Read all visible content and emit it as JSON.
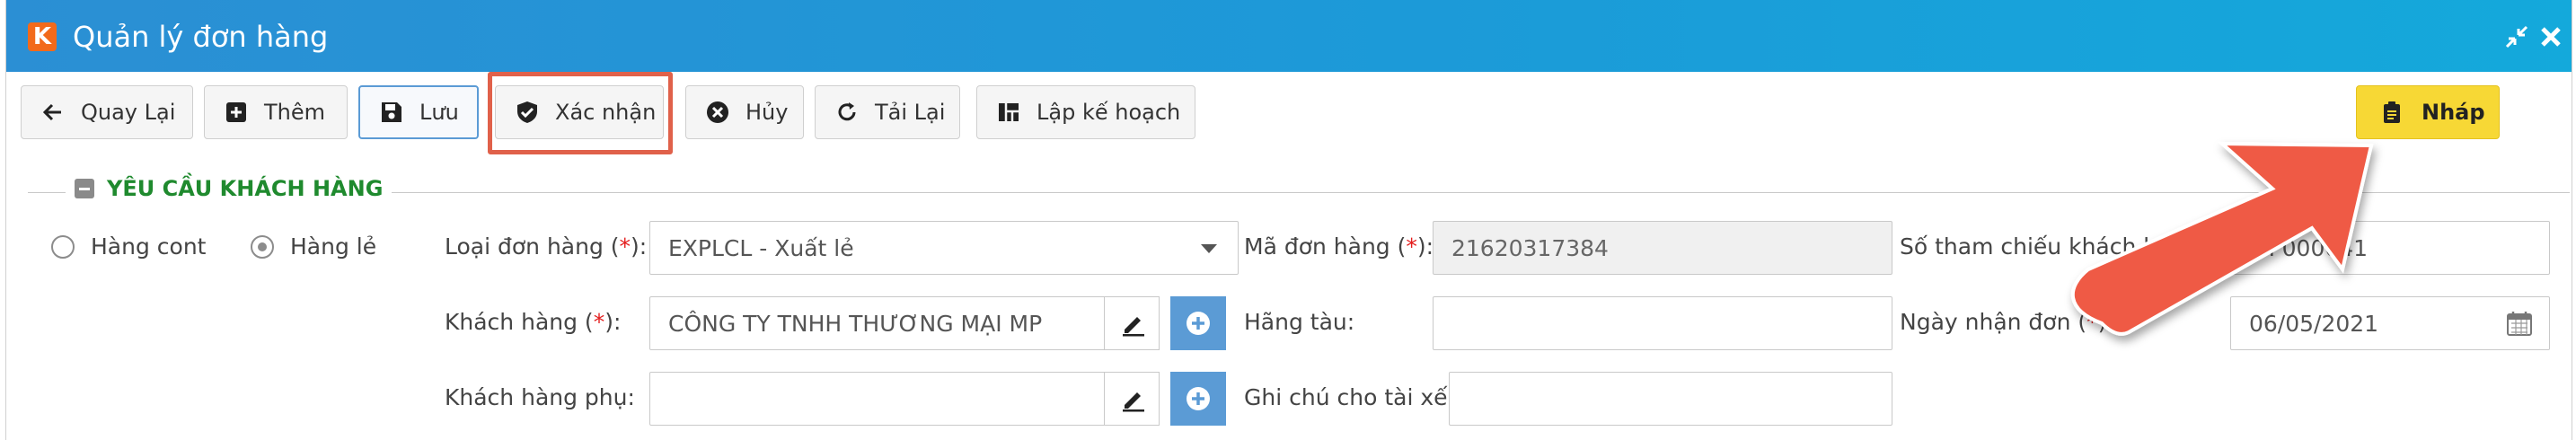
{
  "window": {
    "title": "Quản lý đơn hàng",
    "logo_letter": "K"
  },
  "toolbar": {
    "back_label": "Quay Lại",
    "add_label": "Thêm",
    "save_label": "Lưu",
    "confirm_label": "Xác nhận",
    "cancel_label": "Hủy",
    "reload_label": "Tải Lại",
    "plan_label": "Lập kế hoạch",
    "draft_label": "Nháp"
  },
  "section": {
    "title": "YÊU CẦU KHÁCH HÀNG"
  },
  "order_type": {
    "option_cont": "Hàng cont",
    "option_le": "Hàng lẻ",
    "selected": "Hàng lẻ"
  },
  "form": {
    "loai_don_hang_label": "Loại đơn hàng (",
    "loai_don_hang_value": "EXPLCL - Xuất lẻ",
    "khach_hang_label": "Khách hàng (",
    "khach_hang_value": "CÔNG TY TNHH THƯƠNG MẠI MP",
    "khach_hang_phu_label": "Khách hàng phụ:",
    "khach_hang_phu_value": "",
    "ma_don_hang_label": "Mã đơn hàng (",
    "ma_don_hang_value": "21620317384",
    "hang_tau_label": "Hãng tàu:",
    "hang_tau_value": "",
    "ghi_chu_label": "Ghi chú cho tài xế:",
    "ghi_chu_value": "",
    "so_tham_chieu_label": "Số tham chiếu khách hàng",
    "so_tham_chieu_value": "MP000041",
    "ngay_nhan_don_label": "Ngày nhận đơn (",
    "ngay_nhan_don_value": "06/05/2021",
    "req_star": "*",
    "req_close": "):"
  },
  "colors": {
    "titlebar": "#1c9ad8",
    "accent": "#5b9bd5",
    "draft": "#f7d835",
    "section": "#1f8a2e",
    "annotation": "#ef5a44"
  }
}
